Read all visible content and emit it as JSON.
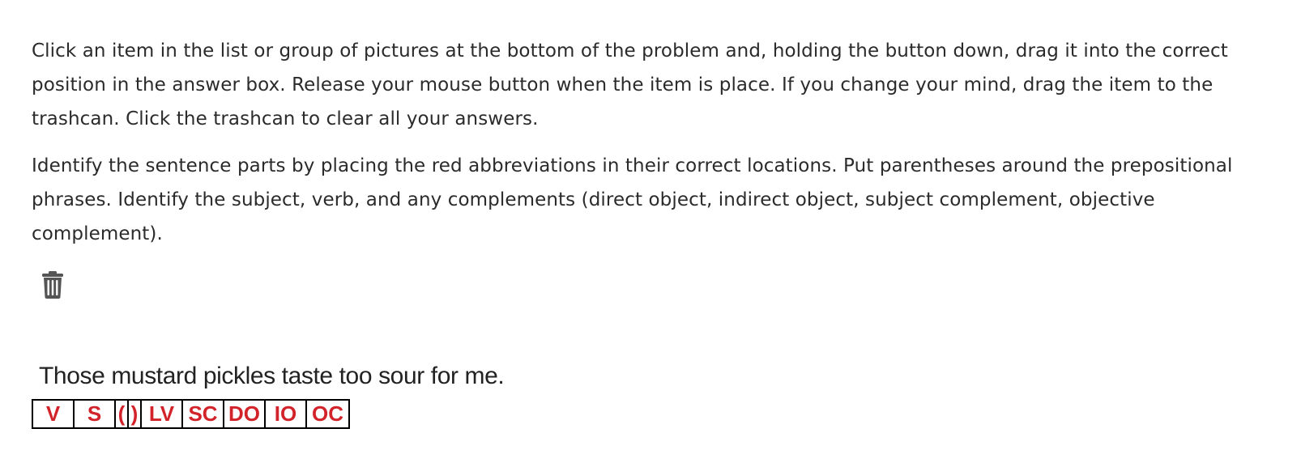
{
  "instructions": {
    "paragraph1": "Click an item in the list or group of pictures at the bottom of the problem and, holding the button down, drag it into the correct position in the answer box. Release your mouse button when the item is place. If you change your mind, drag the item to the trashcan. Click the trashcan to clear all your answers.",
    "paragraph2": "Identify the sentence parts by placing the red abbreviations in their correct locations. Put parentheses around the prepositional phrases. Identify the subject, verb, and any complements (direct object, indirect object, subject complement, objective complement)."
  },
  "trash": {
    "icon": "trash-icon"
  },
  "sentence": {
    "text": "Those mustard pickles taste too sour for me."
  },
  "tiles": {
    "v": "V",
    "s": "S",
    "open_paren": "(",
    "close_paren": ")",
    "lv": "LV",
    "sc": "SC",
    "do": "DO",
    "io": "IO",
    "oc": "OC"
  },
  "colors": {
    "tile_text": "#d2232a",
    "body_text": "#2b2b2b",
    "icon": "#555555"
  }
}
